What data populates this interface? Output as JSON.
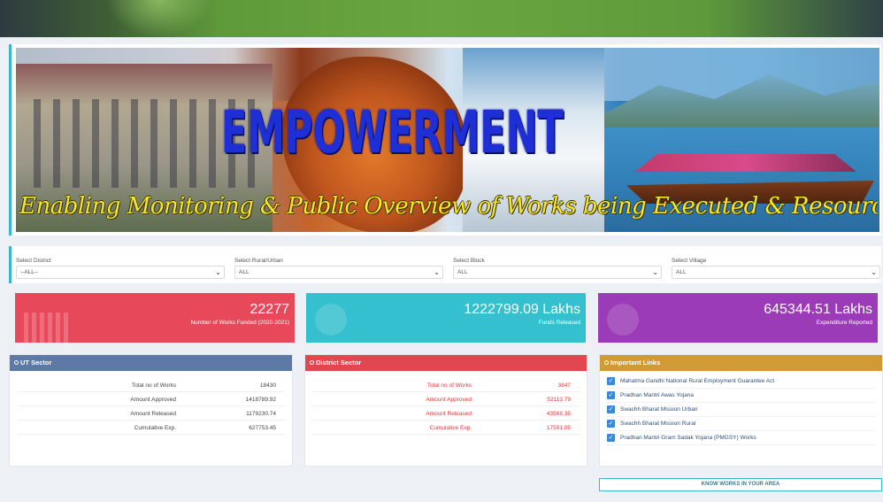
{
  "banner": {
    "title_letters": [
      "E",
      "M",
      "P",
      "O",
      "W",
      "E",
      "R",
      "M",
      "E",
      "N",
      "T"
    ],
    "tagline": "Enabling Monitoring & Public Overview of Works being Executed & Resources for Meaningful Transparency"
  },
  "filters": [
    {
      "label": "Select District",
      "value": "--ALL--"
    },
    {
      "label": "Select Rural/Urban",
      "value": "ALL"
    },
    {
      "label": "Select Block",
      "value": "ALL"
    },
    {
      "label": "Select Village",
      "value": "ALL"
    }
  ],
  "stats": [
    {
      "value": "22277",
      "label": "Number of Works Funded (2020-2021)",
      "color": "#e8495a"
    },
    {
      "value": "1222799.09 Lakhs",
      "label": "Funds Released",
      "color": "#35c0cf"
    },
    {
      "value": "645344.51 Lakhs",
      "label": "Expenditure Reported",
      "color": "#9b3bb7"
    }
  ],
  "ut_sector": {
    "title": "UT Sector",
    "color": "#5d79a5",
    "rows": [
      {
        "label": "Total no of Works",
        "value": "18430"
      },
      {
        "label": "Amount Approved",
        "value": "1418789.92"
      },
      {
        "label": "Amount Released",
        "value": "1179230.74"
      },
      {
        "label": "Cumulative Exp.",
        "value": "627753.45"
      }
    ]
  },
  "district_sector": {
    "title": "District Sector",
    "color": "#e2474f",
    "rows": [
      {
        "label": "Total no of Works",
        "value": "3847"
      },
      {
        "label": "Amount Approved",
        "value": "52113.79"
      },
      {
        "label": "Amount Released",
        "value": "43568.35"
      },
      {
        "label": "Cumulative Exp.",
        "value": "17591.05"
      }
    ]
  },
  "important_links": {
    "title": "Important Links",
    "color": "#d09a36",
    "items": [
      "Mahatma Gandhi National Rural Employment Guarantee Act",
      "Pradhan Mantri Awas Yojana",
      "Swachh Bharat Mission Urban",
      "Swachh Bharat Mission Rural",
      "Pradhan Mantri Gram Sadak Yojana (PMGSY) Works"
    ]
  },
  "know_works_button": "KNOW WORKS IN YOUR AREA"
}
